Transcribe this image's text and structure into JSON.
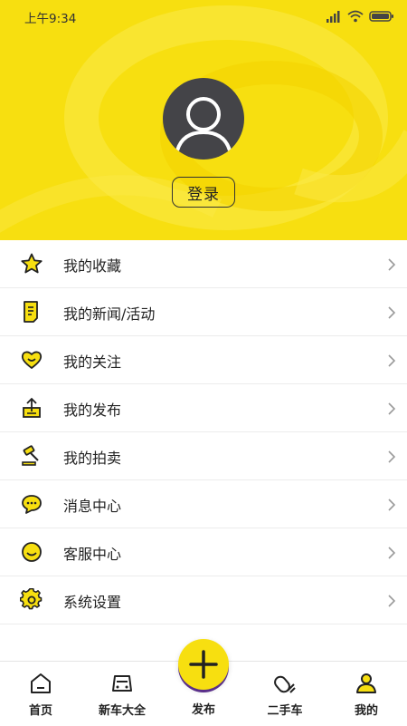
{
  "status": {
    "time": "上午9:34"
  },
  "profile": {
    "login_label": "登录"
  },
  "menu": [
    {
      "label": "我的收藏",
      "icon": "star-icon"
    },
    {
      "label": "我的新闻/活动",
      "icon": "document-icon"
    },
    {
      "label": "我的关注",
      "icon": "heart-icon"
    },
    {
      "label": "我的发布",
      "icon": "upload-icon"
    },
    {
      "label": "我的拍卖",
      "icon": "gavel-icon"
    },
    {
      "label": "消息中心",
      "icon": "chat-bubble-icon"
    },
    {
      "label": "客服中心",
      "icon": "smile-icon"
    },
    {
      "label": "系统设置",
      "icon": "gear-icon"
    }
  ],
  "nav": {
    "home": "首页",
    "new_cars": "新车大全",
    "publish": "发布",
    "used_cars": "二手车",
    "mine": "我的"
  },
  "colors": {
    "accent": "#f7df10",
    "text": "#222222"
  }
}
